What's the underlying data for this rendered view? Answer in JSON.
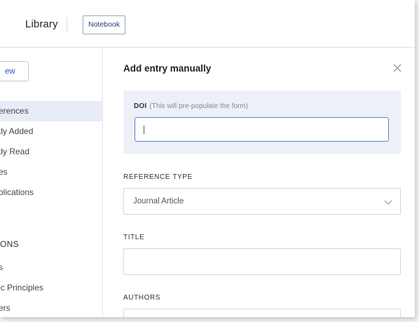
{
  "header": {
    "title": "Library",
    "notebook_button": "Notebook"
  },
  "sidebar": {
    "new_button": "ew",
    "items": [
      {
        "label": "erences",
        "active": true
      },
      {
        "label": "tly Added",
        "active": false
      },
      {
        "label": "tly Read",
        "active": false
      },
      {
        "label": "es",
        "active": false
      },
      {
        "label": "olications",
        "active": false
      }
    ],
    "section_heading": "ONS",
    "section_items": [
      {
        "label": "s"
      },
      {
        "label": "ic Principles"
      },
      {
        "label": "ers"
      }
    ]
  },
  "dialog": {
    "title": "Add entry manually",
    "close_icon": "close-icon",
    "doi": {
      "label": "DOI",
      "hint": "(This will pre-populate the form)",
      "value": ""
    },
    "reference_type": {
      "label": "REFERENCE TYPE",
      "selected": "Journal Article"
    },
    "title_field": {
      "label": "TITLE",
      "value": ""
    },
    "authors_field": {
      "label": "AUTHORS",
      "value": ""
    }
  },
  "colors": {
    "accent": "#5b7fd3",
    "active_nav_bg": "#e8ecf6",
    "doi_panel_bg": "#eef0f7",
    "notebook_text": "#2a3a78"
  }
}
